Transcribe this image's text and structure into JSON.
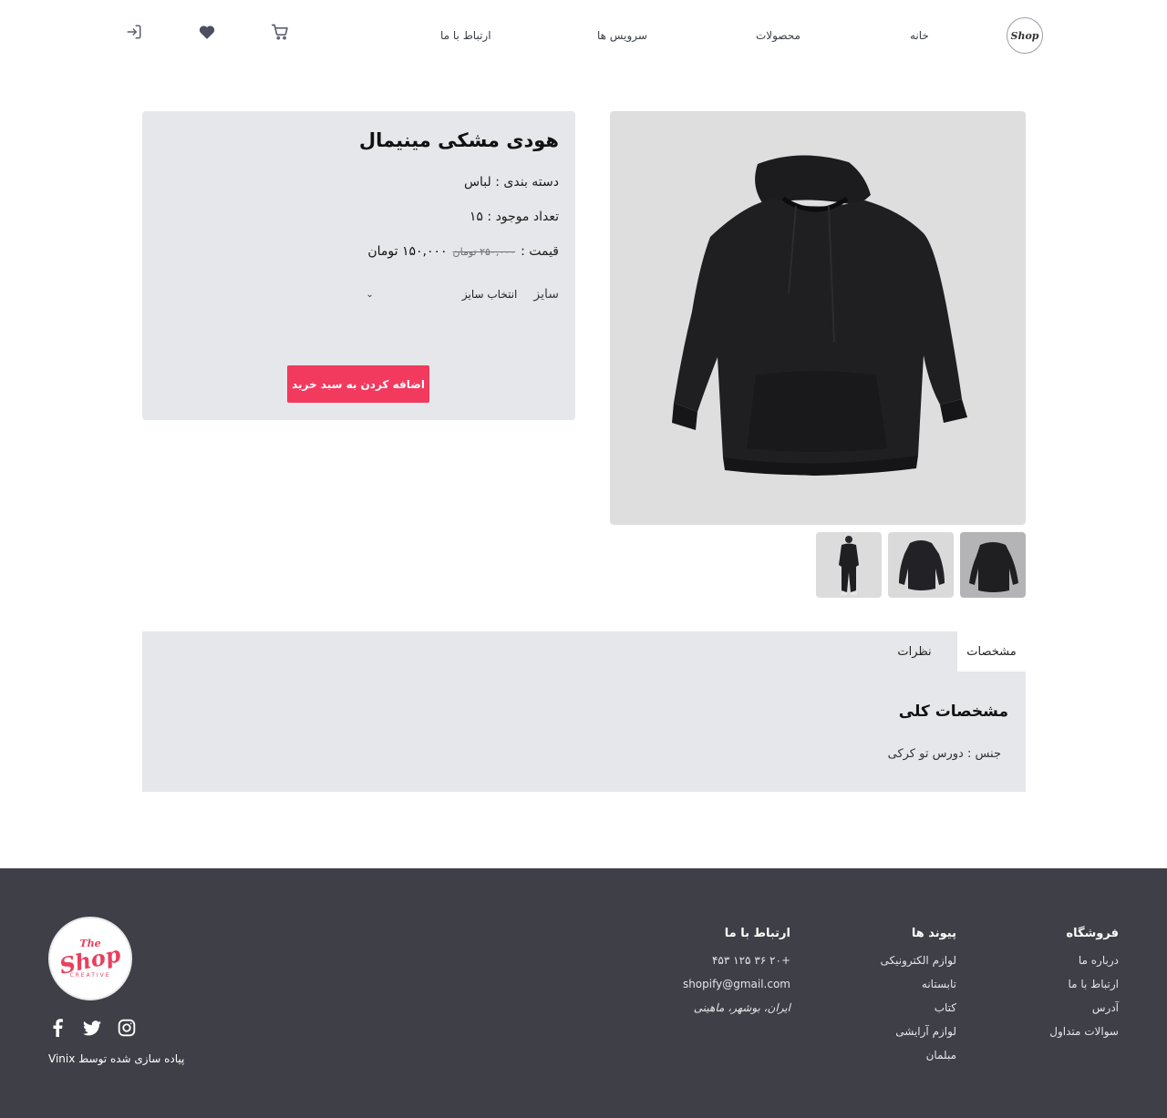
{
  "header": {
    "logo_text": "Shop",
    "nav": [
      {
        "label": "خانه"
      },
      {
        "label": "محصولات"
      },
      {
        "label": "سرویس ها"
      },
      {
        "label": "ارتباط با ما"
      }
    ],
    "icons": [
      "cart-icon",
      "heart-icon",
      "login-icon"
    ]
  },
  "product": {
    "title": "هودی مشکی مینیمال",
    "category": "دسته بندی : لباس",
    "stock": "تعداد موجود : ۱۵",
    "price_label": "قیمت :",
    "old_price": "۲۵۰,۰۰۰ تومان",
    "new_price": "۱۵۰,۰۰۰ تومان",
    "size_label": "سایز",
    "size_placeholder": "انتخاب سایز",
    "add_to_cart": "اضافه کردن به سبد خرید",
    "thumbnails": 3
  },
  "tabs": {
    "items": [
      {
        "label": "مشخصات",
        "active": true
      },
      {
        "label": "نظرات",
        "active": false
      }
    ],
    "spec_heading": "مشخصات کلی",
    "spec_line": "جنس : دورس تو کرکی"
  },
  "footer": {
    "store": {
      "title": "فروشگاه",
      "links": [
        "درباره ما",
        "ارتباط با ما",
        "آدرس",
        "سوالات متداول"
      ]
    },
    "links": {
      "title": "پیوند ها",
      "links": [
        "لوازم الکترونیکی",
        "تابستانه",
        "کتاب",
        "لوازم آرایشی",
        "مبلمان"
      ]
    },
    "contact": {
      "title": "ارتباط با ما",
      "phone": "+۲۰ ۳۶ ۱۲۵ ۴۵۳",
      "email": "shopify@gmail.com",
      "address": "ایران، بوشهر، ماهینی"
    },
    "logo": {
      "line1": "The",
      "line2": "Shop",
      "line3": "CREATIVE"
    },
    "social": [
      "instagram-icon",
      "twitter-icon",
      "facebook-icon"
    ],
    "credit": "پیاده سازی شده توسط Vinix"
  },
  "colors": {
    "accent": "#f23a5e",
    "panel": "#e6e7ea",
    "footer": "#3e3f47"
  }
}
